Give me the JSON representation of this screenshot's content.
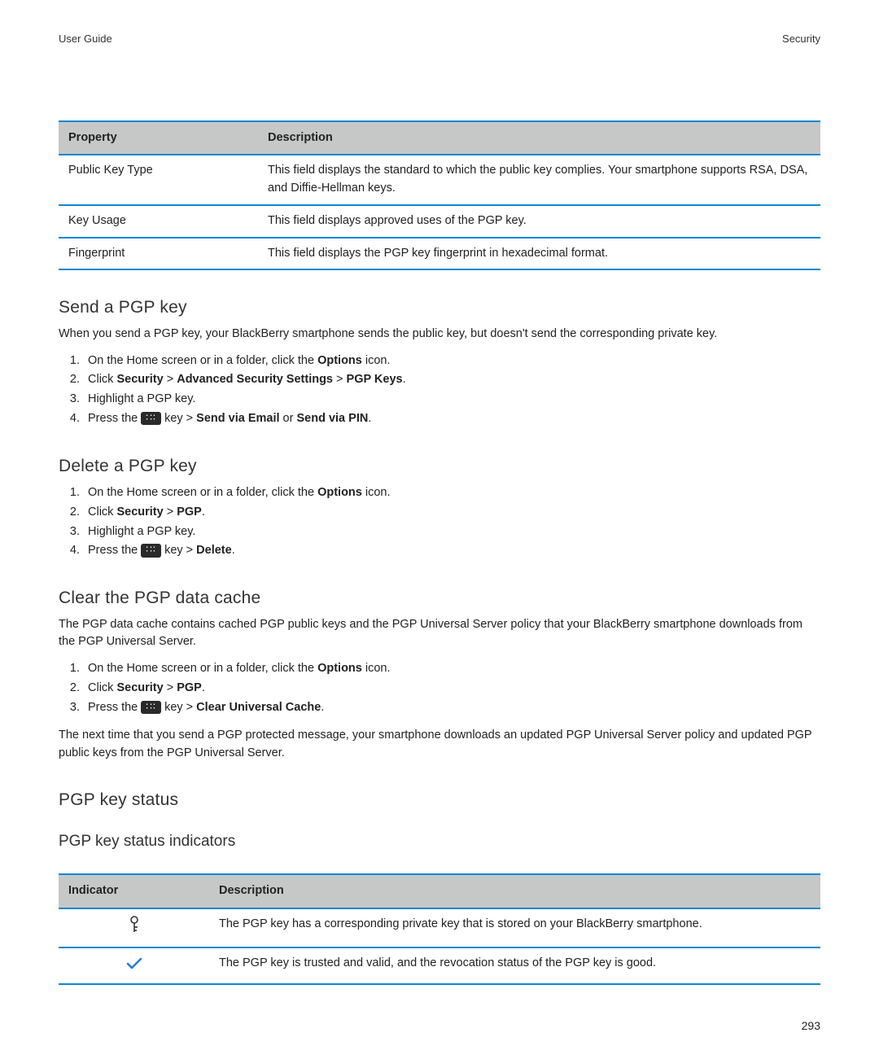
{
  "header": {
    "left": "User Guide",
    "right": "Security"
  },
  "table1": {
    "headers": {
      "property": "Property",
      "description": "Description"
    },
    "rows": [
      {
        "property": "Public Key Type",
        "description": "This field displays the standard to which the public key complies. Your smartphone supports RSA, DSA, and Diffie-Hellman keys."
      },
      {
        "property": "Key Usage",
        "description": "This field displays approved uses of the PGP key."
      },
      {
        "property": "Fingerprint",
        "description": "This field displays the PGP key fingerprint in hexadecimal format."
      }
    ]
  },
  "section_send": {
    "heading": "Send a PGP key",
    "intro": "When you send a PGP key, your BlackBerry smartphone sends the public key, but doesn't send the corresponding private key.",
    "step1_a": "On the Home screen or in a folder, click the ",
    "step1_b": "Options",
    "step1_c": " icon.",
    "step2_a": "Click ",
    "step2_b": "Security",
    "step2_c": " > ",
    "step2_d": "Advanced Security Settings",
    "step2_e": " > ",
    "step2_f": "PGP Keys",
    "step2_g": ".",
    "step3": "Highlight a PGP key.",
    "step4_a": "Press the ",
    "step4_b": " key > ",
    "step4_c": "Send via Email",
    "step4_d": " or ",
    "step4_e": "Send via PIN",
    "step4_f": "."
  },
  "section_delete": {
    "heading": "Delete a PGP key",
    "step1_a": "On the Home screen or in a folder, click the ",
    "step1_b": "Options",
    "step1_c": " icon.",
    "step2_a": "Click ",
    "step2_b": "Security",
    "step2_c": " > ",
    "step2_d": "PGP",
    "step2_e": ".",
    "step3": "Highlight a PGP key.",
    "step4_a": "Press the ",
    "step4_b": " key > ",
    "step4_c": "Delete",
    "step4_d": "."
  },
  "section_clear": {
    "heading": "Clear the PGP data cache",
    "intro": "The PGP data cache contains cached PGP public keys and the PGP Universal Server policy that your BlackBerry smartphone downloads from the PGP Universal Server.",
    "step1_a": "On the Home screen or in a folder, click the ",
    "step1_b": "Options",
    "step1_c": " icon.",
    "step2_a": "Click ",
    "step2_b": "Security",
    "step2_c": " > ",
    "step2_d": "PGP",
    "step2_e": ".",
    "step3_a": "Press the ",
    "step3_b": " key > ",
    "step3_c": "Clear Universal Cache",
    "step3_d": ".",
    "outro": "The next time that you send a PGP protected message, your smartphone downloads an updated PGP Universal Server policy and updated PGP public keys from the PGP Universal Server."
  },
  "section_status": {
    "heading": "PGP key status",
    "sub": "PGP key status indicators"
  },
  "table2": {
    "headers": {
      "indicator": "Indicator",
      "description": "Description"
    },
    "rows": [
      {
        "icon": "private-key",
        "description": "The PGP key has a corresponding private key that is stored on your BlackBerry smartphone."
      },
      {
        "icon": "checkmark",
        "description": "The PGP key is trusted and valid, and the revocation status of the PGP key is good."
      }
    ]
  },
  "page_number": "293"
}
